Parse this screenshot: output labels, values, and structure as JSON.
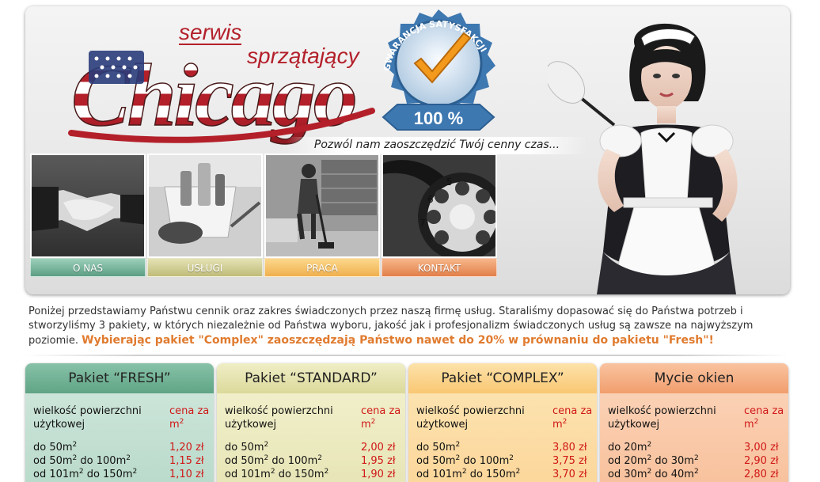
{
  "header": {
    "logo": {
      "line1": "serwis",
      "line2": "sprzątający",
      "brand": "Chicago"
    },
    "badge": {
      "ring_text": "GWARANCJA SATYSFAKCJI",
      "percent": "100 %"
    },
    "slogan": "Pozwól nam zaoszczędzić Twój cenny czas..."
  },
  "nav": {
    "items": [
      {
        "label": "O NAS",
        "icon": "handshake-photo"
      },
      {
        "label": "USŁUGI",
        "icon": "cleaning-supplies-photo"
      },
      {
        "label": "PRACA",
        "icon": "vacuuming-photo"
      },
      {
        "label": "KONTAKT",
        "icon": "rotary-phone-photo"
      }
    ]
  },
  "intro": {
    "text": "Poniżej przedstawiamy Państwu cennik oraz zakres świadczonych przez naszą firmę usług. Staraliśmy dopasować się do Państwa potrzeb i stworzyliśmy 3 pakiety, w których niezależnie od Państwa wyboru, jakość jak i profesjonalizm świadczonych usług są zawsze na najwyższym poziomie.",
    "highlight": "Wybierając pakiet \"Complex\" zaoszczędzają Państwo nawet do 20% w prównaniu do pakietu \"Fresh\"!"
  },
  "packages": [
    {
      "title": "Pakiet “FRESH”",
      "col_label": "wielkość powierzchni użytkowej",
      "col_price": "cena za m",
      "rows": [
        {
          "pre": "do 50m",
          "mid": "",
          "price": "1,20 zł"
        },
        {
          "pre": "od 50m",
          "mid": " do 100m",
          "price": "1,15 zł"
        },
        {
          "pre": "od 101m",
          "mid": " do 150m",
          "price": "1,10 zł"
        }
      ]
    },
    {
      "title": "Pakiet “STANDARD”",
      "col_label": "wielkość powierzchni użytkowej",
      "col_price": "cena za m",
      "rows": [
        {
          "pre": "do 50m",
          "mid": "",
          "price": "2,00 zł"
        },
        {
          "pre": "od 50m",
          "mid": " do 100m",
          "price": "1,95 zł"
        },
        {
          "pre": "od 101m",
          "mid": " do 150m",
          "price": "1,90 zł"
        }
      ]
    },
    {
      "title": "Pakiet “COMPLEX”",
      "col_label": "wielkość powierzchni użytkowej",
      "col_price": "cena za m",
      "rows": [
        {
          "pre": "do 50m",
          "mid": "",
          "price": "3,80 zł"
        },
        {
          "pre": "od 50m",
          "mid": " do 100m",
          "price": "3,75 zł"
        },
        {
          "pre": "od 101m",
          "mid": " do 150m",
          "price": "3,70 zł"
        }
      ]
    },
    {
      "title": "Mycie okien",
      "col_label": "wielkość powierzchni użytkowej",
      "col_price": "cena za m",
      "rows": [
        {
          "pre": "do 20m",
          "mid": "",
          "price": "3,00 zł"
        },
        {
          "pre": "od 20m",
          "mid": " do 30m",
          "price": "2,90 zł"
        },
        {
          "pre": "od 30m",
          "mid": " do 40m",
          "price": "2,80 zł"
        }
      ]
    }
  ],
  "superscript": "2",
  "colors": {
    "highlight": "#e07b2f",
    "price_red": "#d01818",
    "fresh": "#5fa485",
    "standard": "#dcd99a",
    "complex": "#f9c773",
    "windows": "#f19e6d"
  }
}
